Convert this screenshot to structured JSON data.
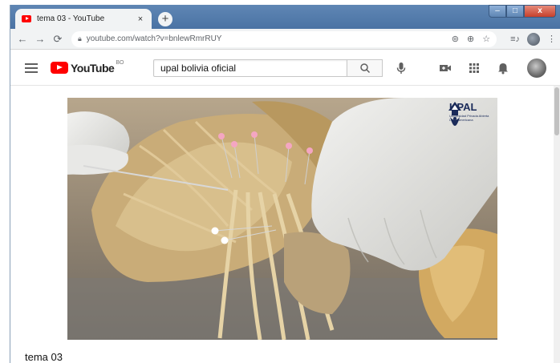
{
  "browser": {
    "tab_title": "tema 03 - YouTube",
    "tab_close": "×",
    "new_tab": "+",
    "url": "youtube.com/watch?v=bnlewRmrRUY",
    "window_controls": {
      "minimize": "–",
      "maximize": "□",
      "close": "x"
    }
  },
  "youtube": {
    "logo_text": "YouTube",
    "region": "BO",
    "search_value": "upal bolivia oficial"
  },
  "video": {
    "watermark_title": "UPAL",
    "watermark_subtitle": "Universidad Privada Abierta Latinoamericana",
    "title": "tema 03"
  },
  "icons": [
    "back-icon",
    "forward-icon",
    "reload-icon",
    "lock-icon",
    "cast-icon",
    "zoom-icon",
    "star-icon",
    "playlist-icon",
    "search-icon",
    "mic-icon",
    "create-video-icon",
    "apps-icon",
    "bell-icon"
  ],
  "colors": {
    "youtube_red": "#ff0000",
    "window_frame": "#5f86b4",
    "close_button": "#c6402c"
  }
}
